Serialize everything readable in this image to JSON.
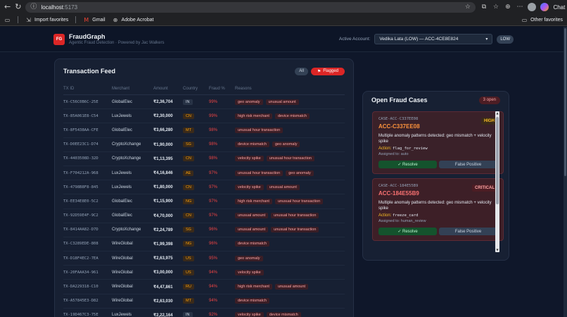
{
  "browser": {
    "url_host": "localhost",
    "url_port": ":5173",
    "chat_label": "Chat",
    "favorites": [
      "Import favorites",
      "Gmail",
      "Adobe Acrobat"
    ],
    "other_favorites": "Other favorites"
  },
  "header": {
    "logo": "FG",
    "title": "FraudGraph",
    "subtitle": "Agentic Fraud Detection · Powered by Jac Walkers",
    "account_label": "Active Account:",
    "account_value": "Vedika Lata (LOW) — ACC-4CE8E824",
    "risk_badge": "LOW"
  },
  "feed": {
    "title": "Transaction Feed",
    "filter_all": "All",
    "filter_flagged": "Flagged",
    "columns": [
      "TX ID",
      "Merchant",
      "Amount",
      "Country",
      "Fraud %",
      "Reasons"
    ],
    "rows": [
      {
        "id": "TX-C56C0B6C-25E",
        "merchant": "GlobalElec",
        "amount": "₹2,36,704",
        "country": "IN",
        "fraud": "99%",
        "reasons": [
          "geo anomaly",
          "unusual amount"
        ]
      },
      {
        "id": "TX-85A061E8-C54",
        "merchant": "LuxJewels",
        "amount": "₹2,30,000",
        "country": "CN",
        "fraud": "99%",
        "reasons": [
          "high risk merchant",
          "device mismatch"
        ]
      },
      {
        "id": "TX-8F5438AA-CFE",
        "merchant": "GlobalElec",
        "amount": "₹3,66,280",
        "country": "MT",
        "fraud": "98%",
        "reasons": [
          "unusual hour transaction"
        ]
      },
      {
        "id": "TX-D0EE23C1-D74",
        "merchant": "CryptoXchange",
        "amount": "₹1,90,000",
        "country": "SG",
        "fraud": "98%",
        "reasons": [
          "device mismatch",
          "geo anomaly"
        ]
      },
      {
        "id": "TX-4403508D-32D",
        "merchant": "CryptoXchange",
        "amount": "₹1,13,395",
        "country": "CN",
        "fraud": "98%",
        "reasons": [
          "velocity spike",
          "unusual hour transaction"
        ]
      },
      {
        "id": "TX-F704212A-968",
        "merchant": "LuxJewels",
        "amount": "₹4,16,846",
        "country": "AE",
        "fraud": "97%",
        "reasons": [
          "unusual hour transaction",
          "geo anomaly"
        ]
      },
      {
        "id": "TX-4798B8F8-845",
        "merchant": "LuxJewels",
        "amount": "₹1,80,000",
        "country": "CN",
        "fraud": "97%",
        "reasons": [
          "velocity spike",
          "unusual amount"
        ]
      },
      {
        "id": "TX-EE34E8E0-5C2",
        "merchant": "GlobalElec",
        "amount": "₹1,15,900",
        "country": "NG",
        "fraud": "97%",
        "reasons": [
          "high risk merchant",
          "unusual hour transaction"
        ]
      },
      {
        "id": "TX-92D59E4F-9C2",
        "merchant": "GlobalElec",
        "amount": "₹4,70,000",
        "country": "CN",
        "fraud": "97%",
        "reasons": [
          "unusual amount",
          "unusual hour transaction"
        ]
      },
      {
        "id": "TX-8414AA82-D7D",
        "merchant": "CryptoXchange",
        "amount": "₹2,24,789",
        "country": "SG",
        "fraud": "96%",
        "reasons": [
          "unusual amount",
          "unusual hour transaction"
        ]
      },
      {
        "id": "TX-C3289EDE-808",
        "merchant": "WireGlobal",
        "amount": "₹1,99,398",
        "country": "NG",
        "fraud": "96%",
        "reasons": [
          "device mismatch"
        ]
      },
      {
        "id": "TX-D18F4EC2-7EA",
        "merchant": "WireGlobal",
        "amount": "₹2,63,975",
        "country": "US",
        "fraud": "95%",
        "reasons": [
          "geo anomaly"
        ]
      },
      {
        "id": "TX-20FAAA34-961",
        "merchant": "WireGlobal",
        "amount": "₹3,00,000",
        "country": "US",
        "fraud": "94%",
        "reasons": [
          "velocity spike"
        ]
      },
      {
        "id": "TX-DA229318-C10",
        "merchant": "WireGlobal",
        "amount": "₹4,47,861",
        "country": "RU",
        "fraud": "94%",
        "reasons": [
          "high risk merchant",
          "unusual amount"
        ]
      },
      {
        "id": "TX-A57845E3-D82",
        "merchant": "WireGlobal",
        "amount": "₹2,63,030",
        "country": "MT",
        "fraud": "94%",
        "reasons": [
          "device mismatch"
        ]
      },
      {
        "id": "TX-19D467C3-75E",
        "merchant": "LuxJewels",
        "amount": "₹2,22,164",
        "country": "IN",
        "fraud": "92%",
        "reasons": [
          "velocity spike",
          "device mismatch"
        ]
      }
    ]
  },
  "cases": {
    "title": "Open Fraud Cases",
    "open_count": "3 open",
    "items": [
      {
        "small_id": "CASE-ACC-C337EE08",
        "severity": "HIGH",
        "id": "ACC-C337EE08",
        "desc": "Multiple anomaly patterns detected: geo mismatch + velocity spike",
        "action_label": "Action:",
        "action": "flag_for_review",
        "assigned": "Assigned to: auto",
        "resolve": "✓ Resolve",
        "false_positive": "False Positive"
      },
      {
        "small_id": "CASE-ACC-184E55B9",
        "severity": "CRITICAL",
        "id": "ACC-184E55B9",
        "desc": "Multiple anomaly patterns detected: geo mismatch + velocity spike",
        "action_label": "Action:",
        "action": "freeze_card",
        "assigned": "Assigned to: human_review",
        "resolve": "✓ Resolve",
        "false_positive": "False Positive"
      }
    ]
  }
}
